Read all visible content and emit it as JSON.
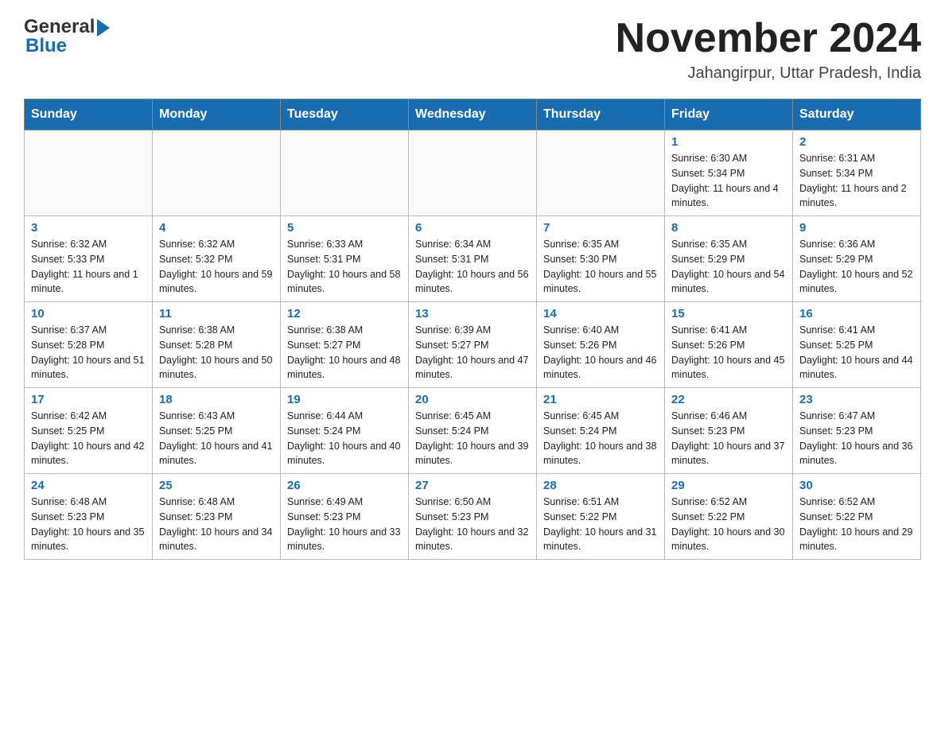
{
  "header": {
    "logo_general": "General",
    "logo_blue": "Blue",
    "month_title": "November 2024",
    "location": "Jahangirpur, Uttar Pradesh, India"
  },
  "weekdays": [
    "Sunday",
    "Monday",
    "Tuesday",
    "Wednesday",
    "Thursday",
    "Friday",
    "Saturday"
  ],
  "weeks": [
    [
      {
        "day": "",
        "sunrise": "",
        "sunset": "",
        "daylight": ""
      },
      {
        "day": "",
        "sunrise": "",
        "sunset": "",
        "daylight": ""
      },
      {
        "day": "",
        "sunrise": "",
        "sunset": "",
        "daylight": ""
      },
      {
        "day": "",
        "sunrise": "",
        "sunset": "",
        "daylight": ""
      },
      {
        "day": "",
        "sunrise": "",
        "sunset": "",
        "daylight": ""
      },
      {
        "day": "1",
        "sunrise": "Sunrise: 6:30 AM",
        "sunset": "Sunset: 5:34 PM",
        "daylight": "Daylight: 11 hours and 4 minutes."
      },
      {
        "day": "2",
        "sunrise": "Sunrise: 6:31 AM",
        "sunset": "Sunset: 5:34 PM",
        "daylight": "Daylight: 11 hours and 2 minutes."
      }
    ],
    [
      {
        "day": "3",
        "sunrise": "Sunrise: 6:32 AM",
        "sunset": "Sunset: 5:33 PM",
        "daylight": "Daylight: 11 hours and 1 minute."
      },
      {
        "day": "4",
        "sunrise": "Sunrise: 6:32 AM",
        "sunset": "Sunset: 5:32 PM",
        "daylight": "Daylight: 10 hours and 59 minutes."
      },
      {
        "day": "5",
        "sunrise": "Sunrise: 6:33 AM",
        "sunset": "Sunset: 5:31 PM",
        "daylight": "Daylight: 10 hours and 58 minutes."
      },
      {
        "day": "6",
        "sunrise": "Sunrise: 6:34 AM",
        "sunset": "Sunset: 5:31 PM",
        "daylight": "Daylight: 10 hours and 56 minutes."
      },
      {
        "day": "7",
        "sunrise": "Sunrise: 6:35 AM",
        "sunset": "Sunset: 5:30 PM",
        "daylight": "Daylight: 10 hours and 55 minutes."
      },
      {
        "day": "8",
        "sunrise": "Sunrise: 6:35 AM",
        "sunset": "Sunset: 5:29 PM",
        "daylight": "Daylight: 10 hours and 54 minutes."
      },
      {
        "day": "9",
        "sunrise": "Sunrise: 6:36 AM",
        "sunset": "Sunset: 5:29 PM",
        "daylight": "Daylight: 10 hours and 52 minutes."
      }
    ],
    [
      {
        "day": "10",
        "sunrise": "Sunrise: 6:37 AM",
        "sunset": "Sunset: 5:28 PM",
        "daylight": "Daylight: 10 hours and 51 minutes."
      },
      {
        "day": "11",
        "sunrise": "Sunrise: 6:38 AM",
        "sunset": "Sunset: 5:28 PM",
        "daylight": "Daylight: 10 hours and 50 minutes."
      },
      {
        "day": "12",
        "sunrise": "Sunrise: 6:38 AM",
        "sunset": "Sunset: 5:27 PM",
        "daylight": "Daylight: 10 hours and 48 minutes."
      },
      {
        "day": "13",
        "sunrise": "Sunrise: 6:39 AM",
        "sunset": "Sunset: 5:27 PM",
        "daylight": "Daylight: 10 hours and 47 minutes."
      },
      {
        "day": "14",
        "sunrise": "Sunrise: 6:40 AM",
        "sunset": "Sunset: 5:26 PM",
        "daylight": "Daylight: 10 hours and 46 minutes."
      },
      {
        "day": "15",
        "sunrise": "Sunrise: 6:41 AM",
        "sunset": "Sunset: 5:26 PM",
        "daylight": "Daylight: 10 hours and 45 minutes."
      },
      {
        "day": "16",
        "sunrise": "Sunrise: 6:41 AM",
        "sunset": "Sunset: 5:25 PM",
        "daylight": "Daylight: 10 hours and 44 minutes."
      }
    ],
    [
      {
        "day": "17",
        "sunrise": "Sunrise: 6:42 AM",
        "sunset": "Sunset: 5:25 PM",
        "daylight": "Daylight: 10 hours and 42 minutes."
      },
      {
        "day": "18",
        "sunrise": "Sunrise: 6:43 AM",
        "sunset": "Sunset: 5:25 PM",
        "daylight": "Daylight: 10 hours and 41 minutes."
      },
      {
        "day": "19",
        "sunrise": "Sunrise: 6:44 AM",
        "sunset": "Sunset: 5:24 PM",
        "daylight": "Daylight: 10 hours and 40 minutes."
      },
      {
        "day": "20",
        "sunrise": "Sunrise: 6:45 AM",
        "sunset": "Sunset: 5:24 PM",
        "daylight": "Daylight: 10 hours and 39 minutes."
      },
      {
        "day": "21",
        "sunrise": "Sunrise: 6:45 AM",
        "sunset": "Sunset: 5:24 PM",
        "daylight": "Daylight: 10 hours and 38 minutes."
      },
      {
        "day": "22",
        "sunrise": "Sunrise: 6:46 AM",
        "sunset": "Sunset: 5:23 PM",
        "daylight": "Daylight: 10 hours and 37 minutes."
      },
      {
        "day": "23",
        "sunrise": "Sunrise: 6:47 AM",
        "sunset": "Sunset: 5:23 PM",
        "daylight": "Daylight: 10 hours and 36 minutes."
      }
    ],
    [
      {
        "day": "24",
        "sunrise": "Sunrise: 6:48 AM",
        "sunset": "Sunset: 5:23 PM",
        "daylight": "Daylight: 10 hours and 35 minutes."
      },
      {
        "day": "25",
        "sunrise": "Sunrise: 6:48 AM",
        "sunset": "Sunset: 5:23 PM",
        "daylight": "Daylight: 10 hours and 34 minutes."
      },
      {
        "day": "26",
        "sunrise": "Sunrise: 6:49 AM",
        "sunset": "Sunset: 5:23 PM",
        "daylight": "Daylight: 10 hours and 33 minutes."
      },
      {
        "day": "27",
        "sunrise": "Sunrise: 6:50 AM",
        "sunset": "Sunset: 5:23 PM",
        "daylight": "Daylight: 10 hours and 32 minutes."
      },
      {
        "day": "28",
        "sunrise": "Sunrise: 6:51 AM",
        "sunset": "Sunset: 5:22 PM",
        "daylight": "Daylight: 10 hours and 31 minutes."
      },
      {
        "day": "29",
        "sunrise": "Sunrise: 6:52 AM",
        "sunset": "Sunset: 5:22 PM",
        "daylight": "Daylight: 10 hours and 30 minutes."
      },
      {
        "day": "30",
        "sunrise": "Sunrise: 6:52 AM",
        "sunset": "Sunset: 5:22 PM",
        "daylight": "Daylight: 10 hours and 29 minutes."
      }
    ]
  ]
}
